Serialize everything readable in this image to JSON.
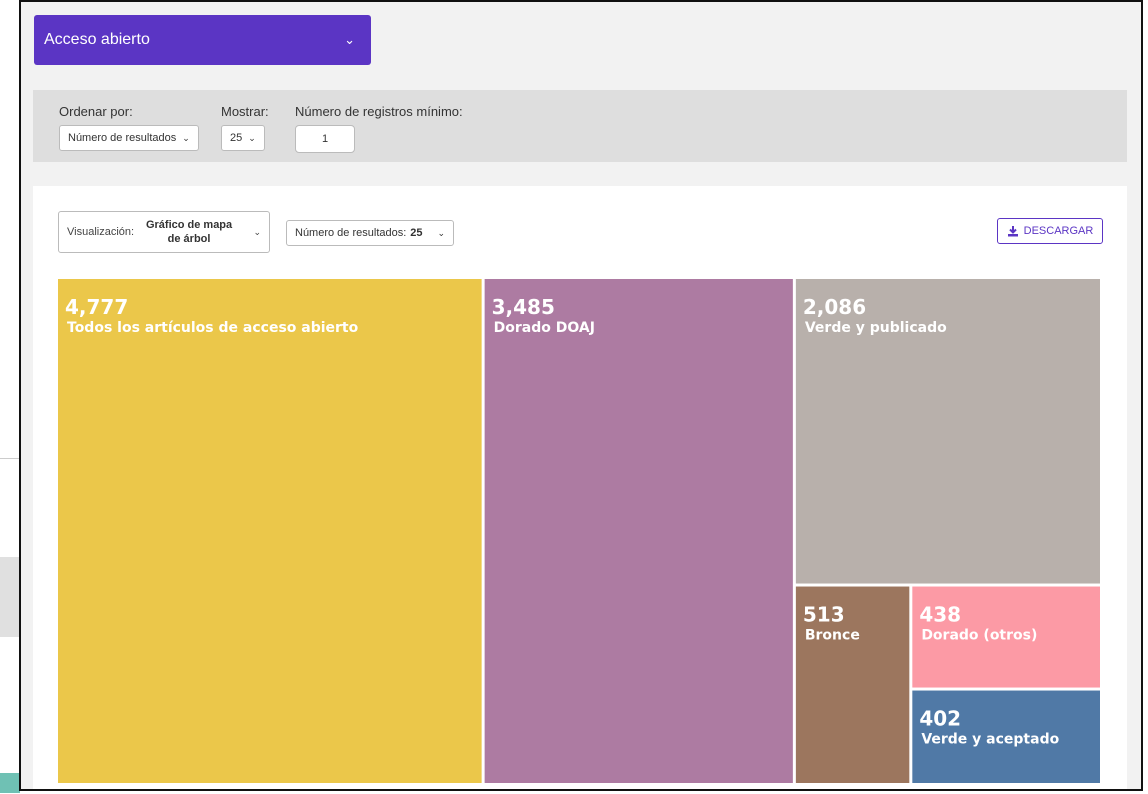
{
  "filter_select": {
    "value": "Acceso abierto"
  },
  "filters": {
    "sort_label": "Ordenar por:",
    "sort_value": "Número de resultados",
    "show_label": "Mostrar:",
    "show_value": "25",
    "min_label": "Número de registros mínimo:",
    "min_value": "1"
  },
  "toolbar": {
    "viz_label": "Visualización:",
    "viz_value": "Gráfico de mapa de árbol",
    "count_label": "Número de resultados:",
    "count_value": "25",
    "download_label": "DESCARGAR"
  },
  "icons": {
    "dropdown": "chevron-down-icon",
    "download": "download-icon"
  },
  "colors": {
    "accent": "#5b35c4"
  },
  "chart_data": {
    "type": "treemap",
    "title": "",
    "items": [
      {
        "label": "Todos los artículos de acceso abierto",
        "value": 4777,
        "display": "4,777",
        "color": "#ebc74a"
      },
      {
        "label": "Dorado DOAJ",
        "value": 3485,
        "display": "3,485",
        "color": "#ad7ba2"
      },
      {
        "label": "Verde y publicado",
        "value": 2086,
        "display": "2,086",
        "color": "#b8b0ab"
      },
      {
        "label": "Bronce",
        "value": 513,
        "display": "513",
        "color": "#9c765e"
      },
      {
        "label": "Dorado (otros)",
        "value": 438,
        "display": "438",
        "color": "#fc9aa5"
      },
      {
        "label": "Verde y aceptado",
        "value": 402,
        "display": "402",
        "color": "#5079a6"
      }
    ]
  }
}
